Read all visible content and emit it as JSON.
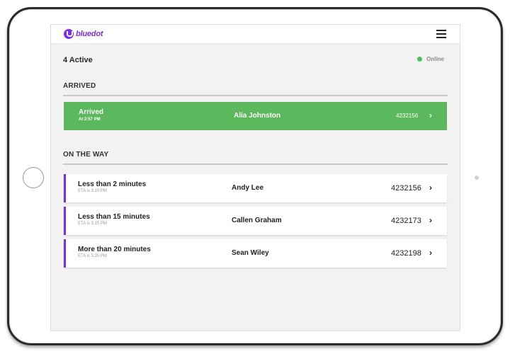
{
  "header": {
    "brand": "bluedot",
    "menu_icon": "hamburger-menu-icon"
  },
  "summary": {
    "active_count": "4 Active",
    "status_text": "Online",
    "status_color": "#4cc25a"
  },
  "arrived": {
    "heading": "ARRIVED",
    "items": [
      {
        "title": "Arrived",
        "time": "At 2:57 PM",
        "name": "Alia Johnston",
        "order": "4232156",
        "chevron": "›"
      }
    ]
  },
  "on_the_way": {
    "heading": "ON THE WAY",
    "items": [
      {
        "eta": "Less than 2 minutes",
        "eta_time": "ETA is 3:10 PM",
        "name": "Andy Lee",
        "order": "4232156",
        "chevron": "›"
      },
      {
        "eta": "Less than 15 minutes",
        "eta_time": "ETA is 3:15 PM",
        "name": "Callen Graham",
        "order": "4232173",
        "chevron": "›"
      },
      {
        "eta": "More than 20 minutes",
        "eta_time": "ETA is 3:20 PM",
        "name": "Sean Wiley",
        "order": "4232198",
        "chevron": "›"
      }
    ]
  },
  "colors": {
    "brand": "#7b2ee6",
    "arrived_card": "#5cb85c"
  }
}
